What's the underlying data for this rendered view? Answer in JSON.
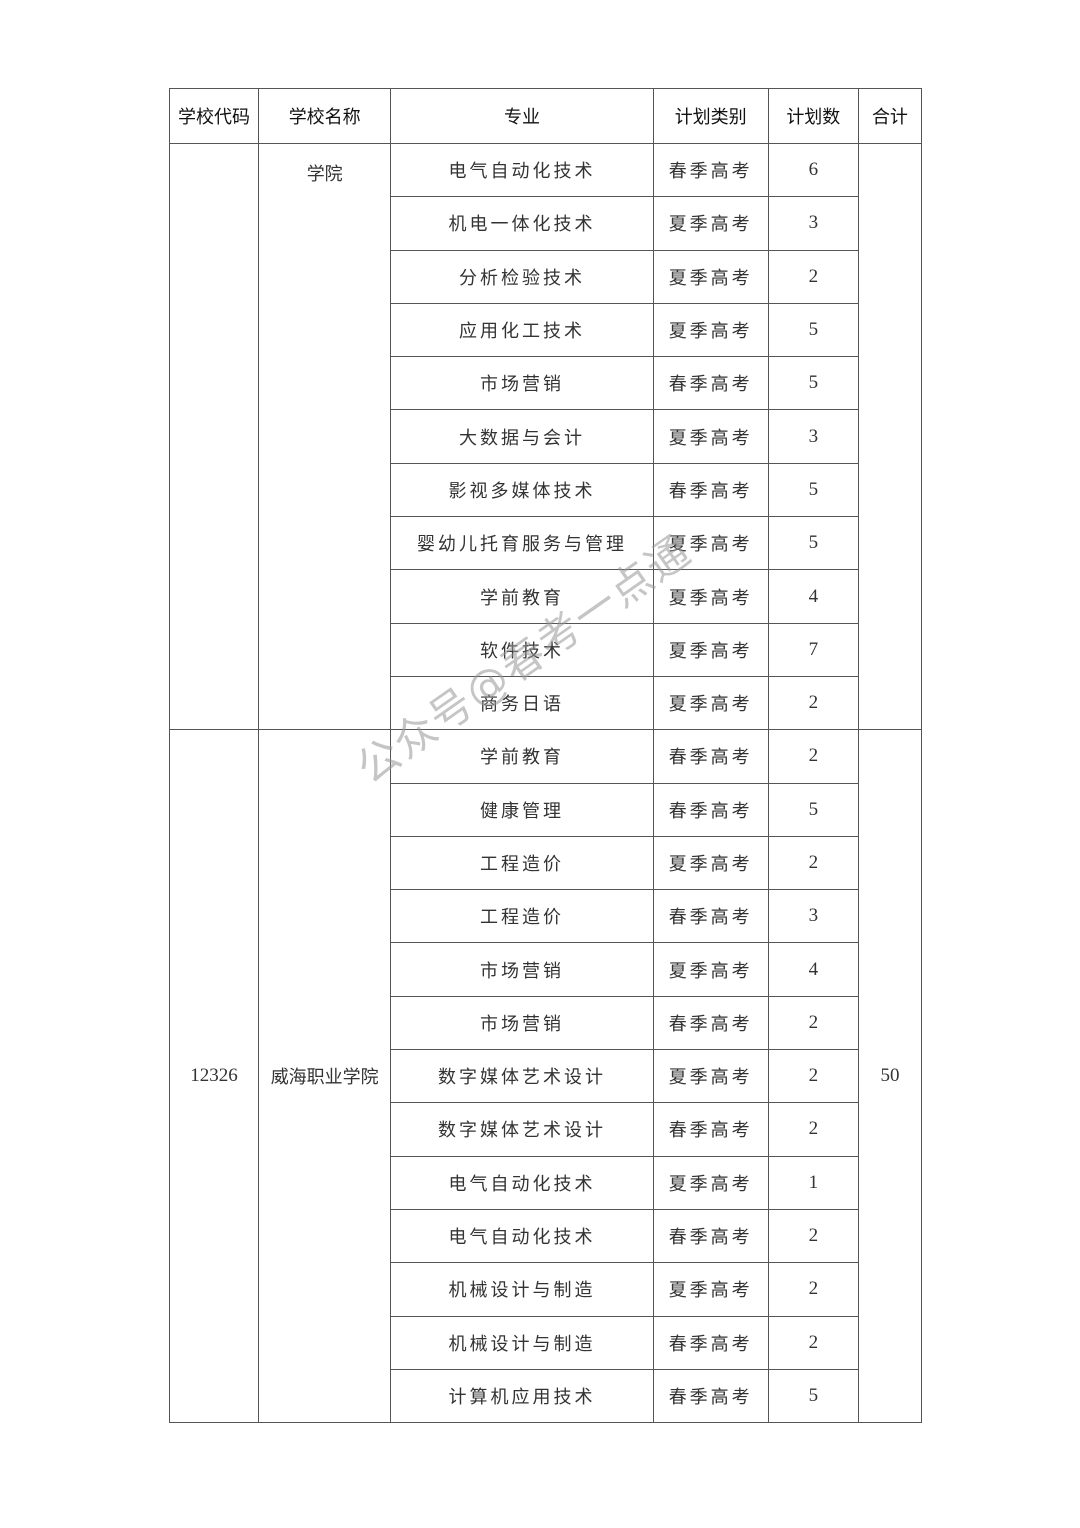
{
  "headers": [
    "学校代码",
    "学校名称",
    "专业",
    "计划类别",
    "计划数",
    "合计"
  ],
  "group1": {
    "school_code": "",
    "school_name": "学院",
    "total": "",
    "rows": [
      {
        "major": "电气自动化技术",
        "category": "春季高考",
        "count": "6"
      },
      {
        "major": "机电一体化技术",
        "category": "夏季高考",
        "count": "3"
      },
      {
        "major": "分析检验技术",
        "category": "夏季高考",
        "count": "2"
      },
      {
        "major": "应用化工技术",
        "category": "夏季高考",
        "count": "5"
      },
      {
        "major": "市场营销",
        "category": "春季高考",
        "count": "5"
      },
      {
        "major": "大数据与会计",
        "category": "夏季高考",
        "count": "3"
      },
      {
        "major": "影视多媒体技术",
        "category": "春季高考",
        "count": "5"
      },
      {
        "major": "婴幼儿托育服务与管理",
        "category": "夏季高考",
        "count": "5"
      },
      {
        "major": "学前教育",
        "category": "夏季高考",
        "count": "4"
      },
      {
        "major": "软件技术",
        "category": "夏季高考",
        "count": "7"
      },
      {
        "major": "商务日语",
        "category": "夏季高考",
        "count": "2"
      }
    ]
  },
  "group2": {
    "school_code": "12326",
    "school_name": "威海职业学院",
    "total": "50",
    "rows": [
      {
        "major": "学前教育",
        "category": "春季高考",
        "count": "2"
      },
      {
        "major": "健康管理",
        "category": "春季高考",
        "count": "5"
      },
      {
        "major": "工程造价",
        "category": "夏季高考",
        "count": "2"
      },
      {
        "major": "工程造价",
        "category": "春季高考",
        "count": "3"
      },
      {
        "major": "市场营销",
        "category": "夏季高考",
        "count": "4"
      },
      {
        "major": "市场营销",
        "category": "春季高考",
        "count": "2"
      },
      {
        "major": "数字媒体艺术设计",
        "category": "夏季高考",
        "count": "2"
      },
      {
        "major": "数字媒体艺术设计",
        "category": "春季高考",
        "count": "2"
      },
      {
        "major": "电气自动化技术",
        "category": "夏季高考",
        "count": "1"
      },
      {
        "major": "电气自动化技术",
        "category": "春季高考",
        "count": "2"
      },
      {
        "major": "机械设计与制造",
        "category": "夏季高考",
        "count": "2"
      },
      {
        "major": "机械设计与制造",
        "category": "春季高考",
        "count": "2"
      },
      {
        "major": "计算机应用技术",
        "category": "春季高考",
        "count": "5"
      }
    ]
  },
  "watermark": "公众号@春考一点通"
}
